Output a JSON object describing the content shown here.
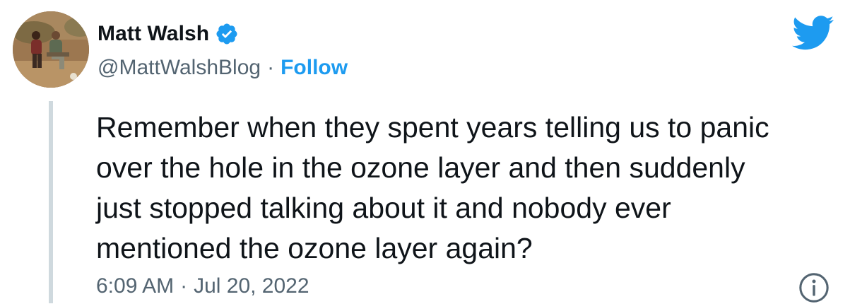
{
  "author": {
    "display_name": "Matt Walsh",
    "handle": "@MattWalshBlog",
    "separator": "·",
    "follow_label": "Follow",
    "verified": true
  },
  "tweet": {
    "text": "Remember when they spent years telling us to panic\nover the hole in the ozone layer and then suddenly\njust stopped talking about it and nobody ever\nmentioned the ozone layer again?",
    "time": "6:09 AM",
    "separator": "·",
    "date": "Jul 20, 2022"
  },
  "icons": {
    "verified": "verified-badge-icon",
    "brand": "twitter-bird-icon",
    "info": "info-icon"
  },
  "colors": {
    "accent": "#1d9bf0",
    "text": "#0f1419",
    "secondary_text": "#536471",
    "thread_line": "#cfd9de"
  }
}
